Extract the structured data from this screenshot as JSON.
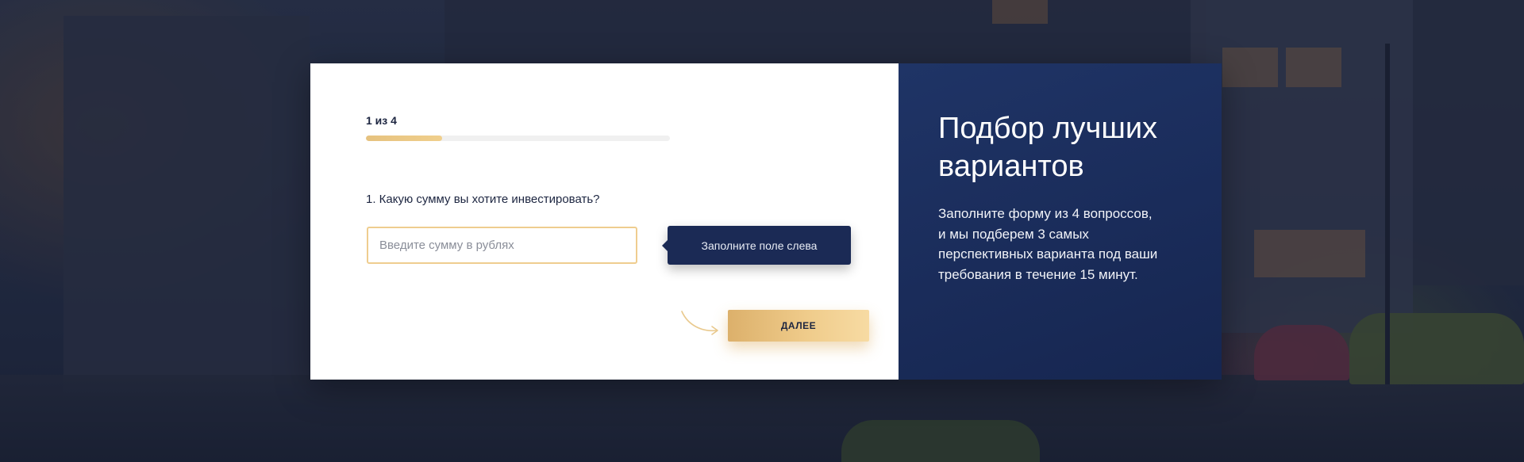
{
  "quiz": {
    "step_counter": "1 из 4",
    "progress_fraction": 0.25,
    "question": "1. Какую сумму вы хотите инвестировать?",
    "input": {
      "value": "",
      "placeholder": "Введите сумму в рублях"
    },
    "hint_tooltip": "Заполните поле слева",
    "next_button_label": "ДАЛЕЕ"
  },
  "panel": {
    "title_line1": "Подбор лучших",
    "title_line2": "вариантов",
    "desc_line1": "Заполните форму из 4 вопроссов,",
    "desc_line2": "и мы подберем 3 самых",
    "desc_line3": "перспективных  варианта под ваши",
    "desc_line4": "требования в течение 15 минут."
  },
  "colors": {
    "accent_gold": "#efcb8a",
    "panel_navy": "#1b2d5c",
    "tooltip_navy": "#1b2a55",
    "text_dark": "#1c2540"
  },
  "icons": {
    "decor_arrow": "curved-arrow-right-icon"
  }
}
